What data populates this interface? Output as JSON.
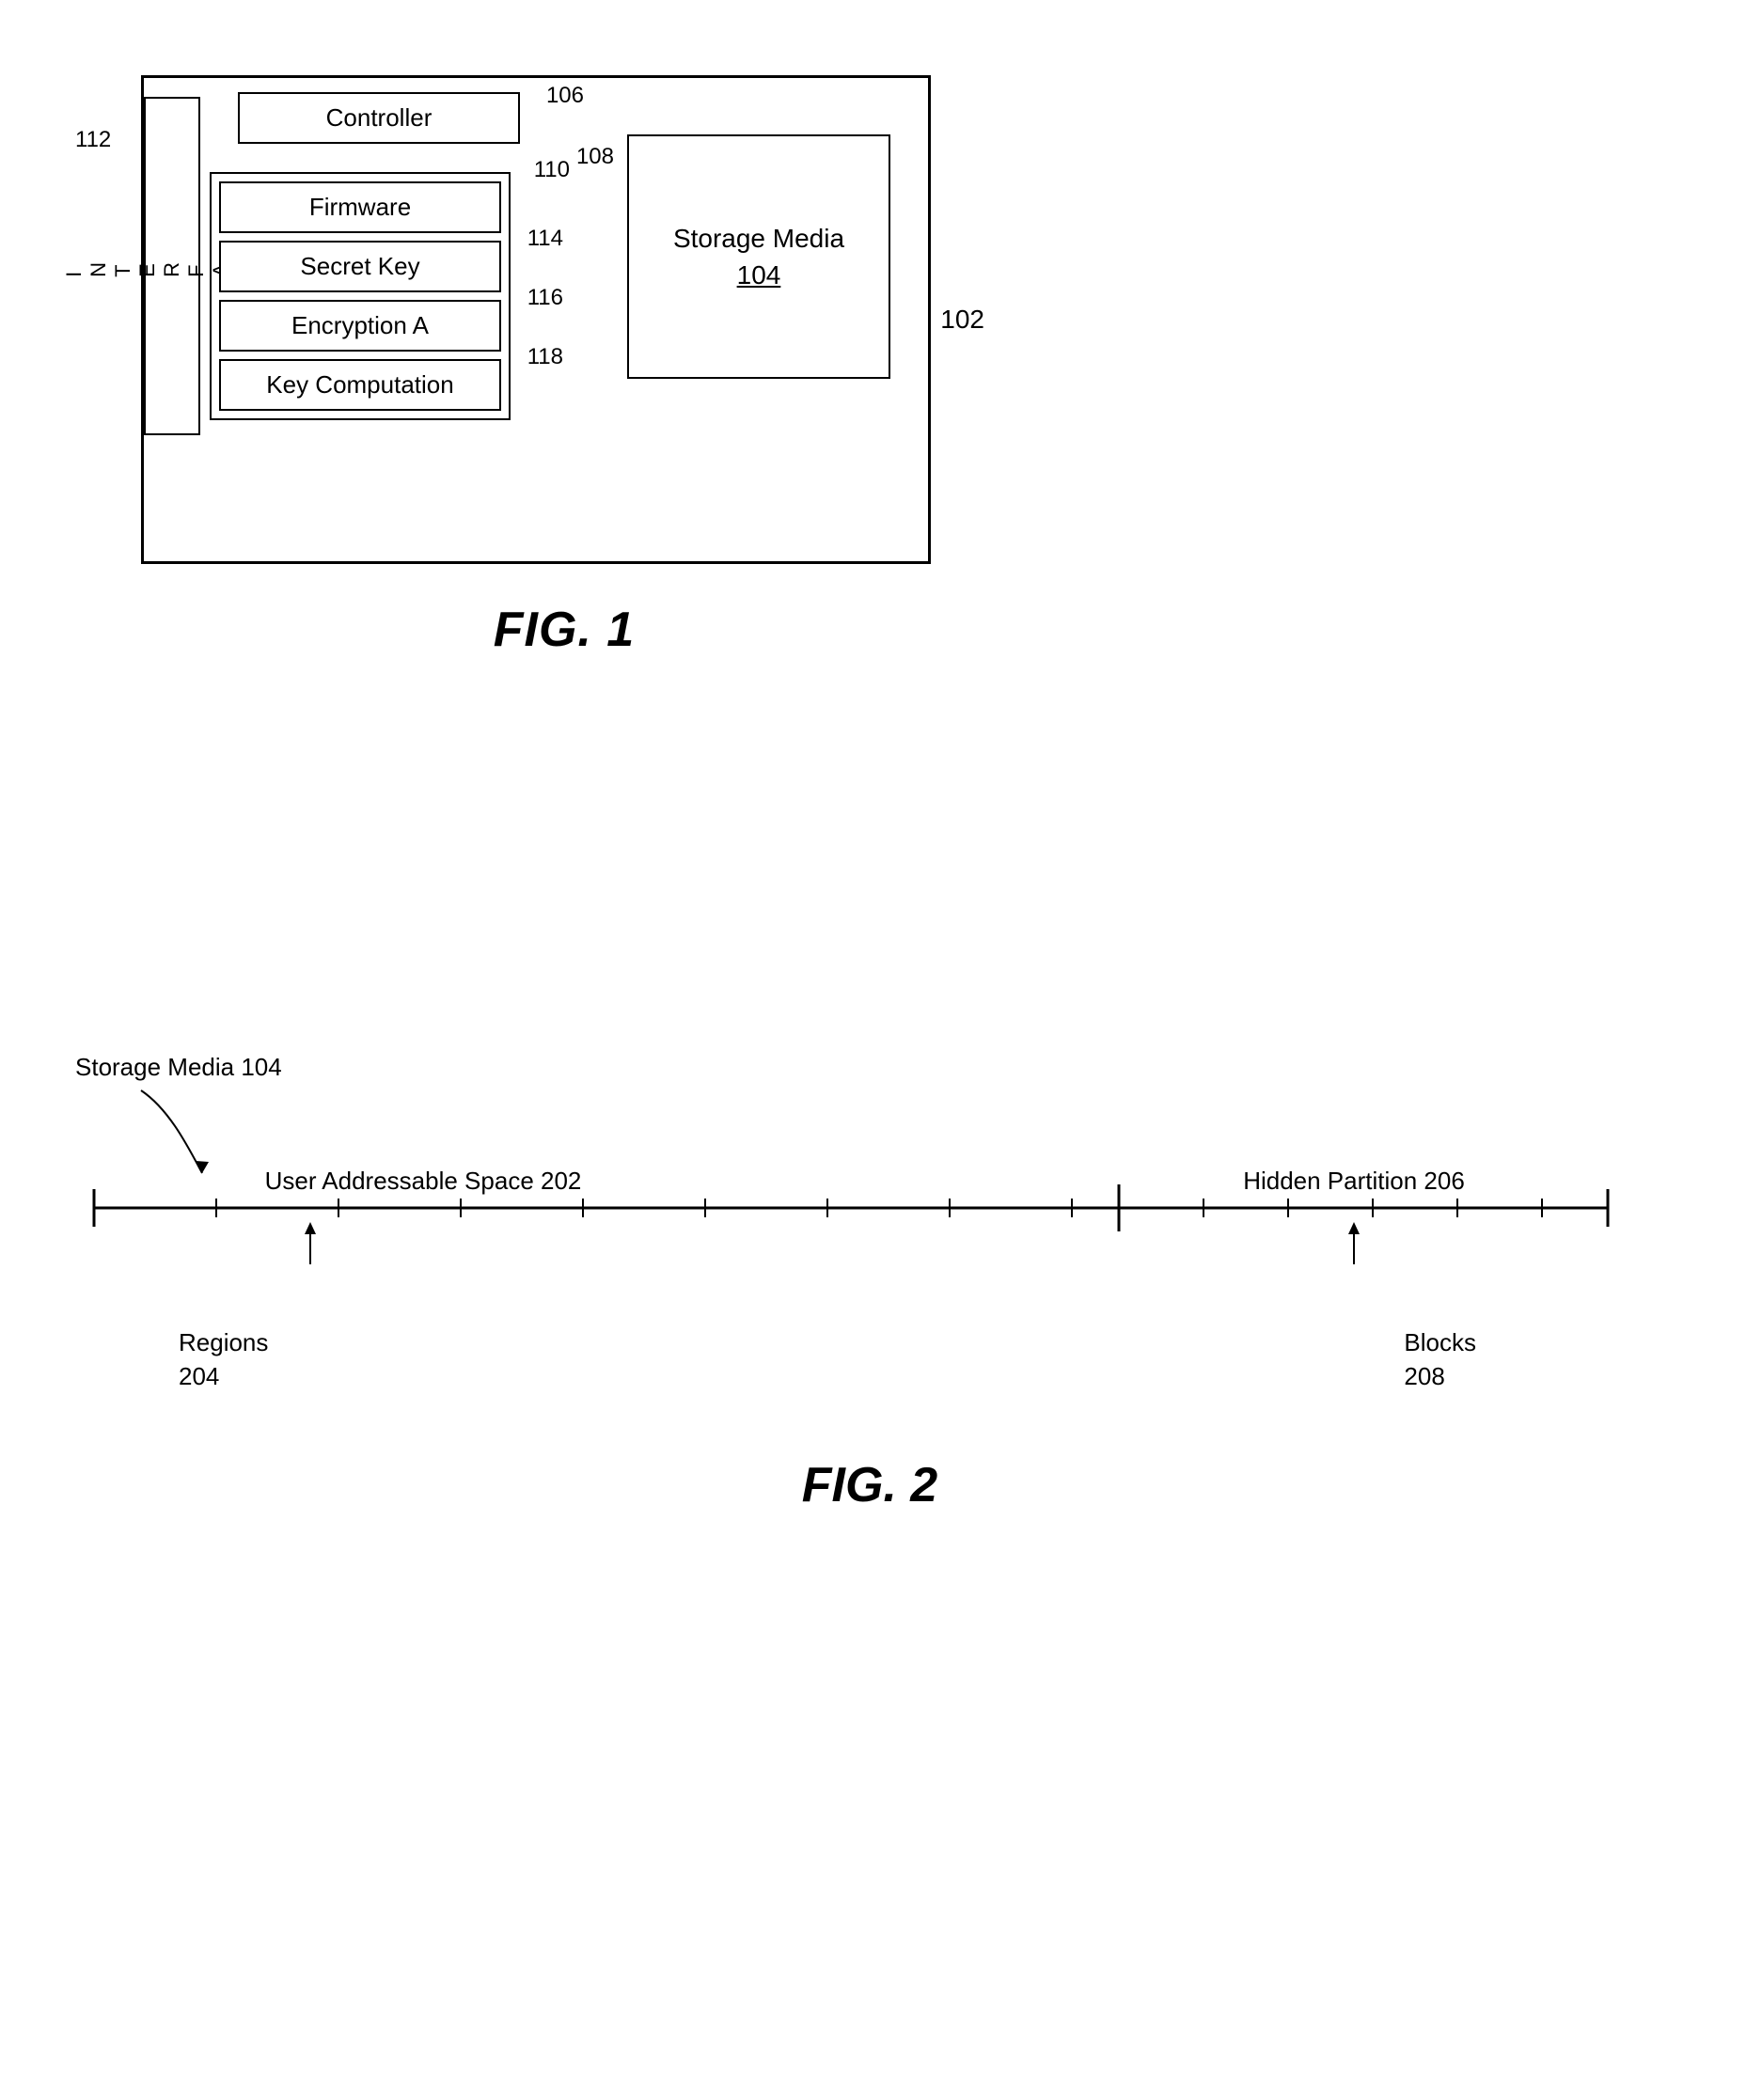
{
  "fig1": {
    "title": "FIG. 1",
    "outer_label": "102",
    "interface_label": "112",
    "interface_text": "I\nN\nT\nE\nR\nF\nA\nC\nE",
    "controller_label": "Controller",
    "label_106": "106",
    "label_108": "108",
    "inner_box_label": "110",
    "firmware_label": "Firmware",
    "secret_key_label": "Secret Key",
    "label_114": "114",
    "encryption_label": "Encryption A",
    "label_116": "116",
    "key_computation_label": "Key Computation",
    "label_118": "118",
    "storage_media_label": "Storage Media",
    "storage_media_num": "104"
  },
  "fig2": {
    "title": "FIG. 2",
    "storage_media_label": "Storage Media 104",
    "user_space_label": "User Addressable Space 202",
    "hidden_partition_label": "Hidden Partition 206",
    "regions_label": "Regions",
    "regions_num": "204",
    "blocks_label": "Blocks",
    "blocks_num": "208"
  }
}
